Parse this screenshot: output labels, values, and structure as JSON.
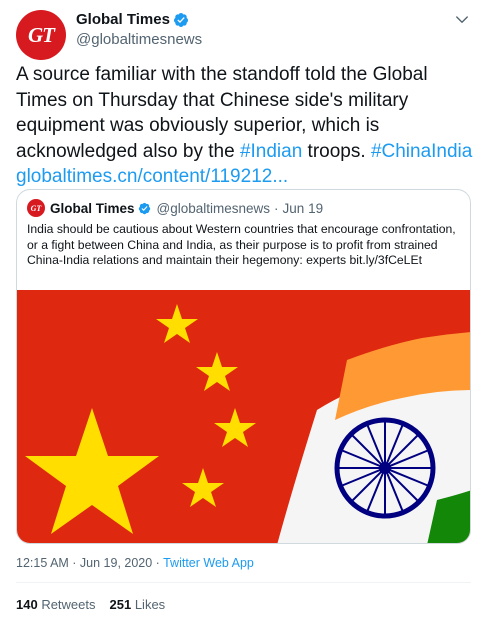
{
  "author": {
    "name": "Global Times",
    "handle": "@globaltimesnews",
    "avatar_text": "GT"
  },
  "tweet": {
    "text_main": "A source familiar with the standoff told the Global Times on Thursday that Chinese side's military equipment was obviously superior, which is acknowledged also by the ",
    "hashtag1": "#Indian",
    "text_mid": " troops. ",
    "hashtag2": "#ChinaIndia",
    "link": "globaltimes.cn/content/119212..."
  },
  "quoted": {
    "name": "Global Times",
    "handle": "@globaltimesnews",
    "dot": "·",
    "date": "Jun 19",
    "avatar_text": "GT",
    "text": "India should be cautious about Western countries that encourage confrontation, or a fight between China and India, as their purpose is to profit from strained China-India relations and maintain their hegemony: experts bit.ly/3fCeLEt",
    "image_alt": "China and India flags"
  },
  "meta": {
    "time": "12:15 AM · Jun 19, 2020 · ",
    "source": "Twitter Web App"
  },
  "stats": {
    "retweets_count": "140",
    "retweets_label": " Retweets",
    "likes_count": "251",
    "likes_label": " Likes"
  },
  "colors": {
    "accent": "#1d9bf0",
    "brand_red": "#d71920",
    "china_red": "#de2910",
    "china_star": "#ffde00",
    "india_saffron": "#ff9933",
    "india_green": "#138808",
    "chakra_blue": "#000080"
  },
  "icons": [
    "verified-badge-icon",
    "chevron-down-icon"
  ]
}
